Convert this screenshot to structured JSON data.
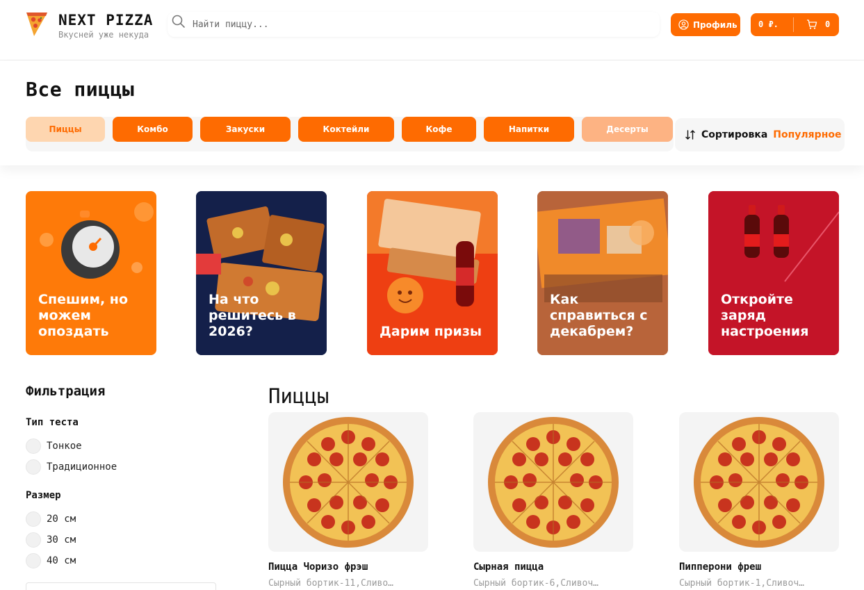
{
  "header": {
    "brand": "NEXT PIZZA",
    "tagline": "Вкусней уже некуда",
    "search_placeholder": "Найти пиццу...",
    "profile_label": "Профиль",
    "cart_price": "0 ₽.",
    "cart_count": "0"
  },
  "colors": {
    "accent": "#fe6b01",
    "accent_light": "#fed6b0"
  },
  "page": {
    "title": "Все пиццы",
    "categories": [
      "Пиццы",
      "Комбо",
      "Закуски",
      "Коктейли",
      "Кофе",
      "Напитки",
      "Десерты"
    ],
    "active_category": "Пиццы",
    "sort_label": "Сортировка",
    "sort_value": "Популярное"
  },
  "stories": [
    {
      "text": "Спешим, но можем опоздать"
    },
    {
      "text": "На что решитесь в 2026?"
    },
    {
      "text": "Дарим призы"
    },
    {
      "text": "Как справиться с декабрем?"
    },
    {
      "text": "Откройте заряд настроения"
    }
  ],
  "filters": {
    "title": "Фильтрация",
    "dough_title": "Тип теста",
    "dough_options": [
      "Тонкое",
      "Традиционное"
    ],
    "size_title": "Размер",
    "size_options": [
      "20 см",
      "30 см",
      "40 см"
    ]
  },
  "products": {
    "title": "Пиццы",
    "items": [
      {
        "name": "Пицца Чоризо фрэш",
        "desc": "Сырный бортик-11,Сливо…"
      },
      {
        "name": "Сырная пицца",
        "desc": "Сырный бортик-6,Сливоч…"
      },
      {
        "name": "Пипперони фреш",
        "desc": "Сырный бортик-1,Сливоч…"
      }
    ]
  }
}
